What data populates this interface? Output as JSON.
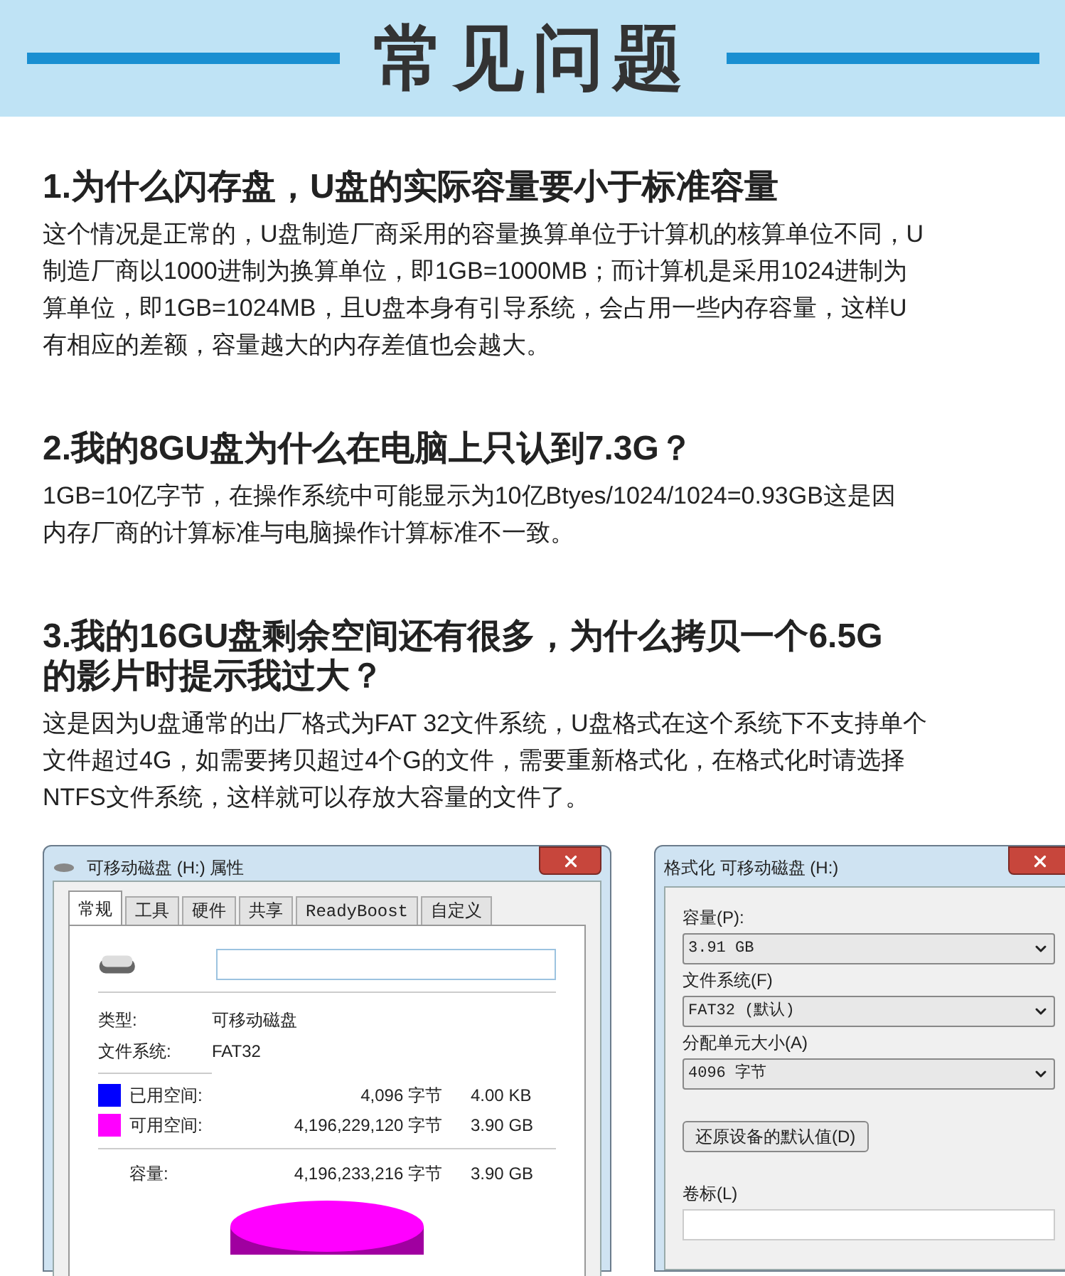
{
  "header": {
    "title": "常见问题"
  },
  "faq": [
    {
      "title_lines": [
        "1.为什么闪存盘，U盘的实际容量要小于标准容量"
      ],
      "body_lines": [
        "这个情况是正常的，U盘制造厂商采用的容量换算单位于计算机的核算单位不同，U",
        "制造厂商以1000进制为换算单位，即1GB=1000MB；而计算机是采用1024进制为",
        "算单位，即1GB=1024MB，且U盘本身有引导系统，会占用一些内存容量，这样U",
        "有相应的差额，容量越大的内存差值也会越大。"
      ]
    },
    {
      "title_lines": [
        "2.我的8GU盘为什么在电脑上只认到7.3G？"
      ],
      "body_lines": [
        "1GB=10亿字节，在操作系统中可能显示为10亿Btyes/1024/1024=0.93GB这是因",
        "内存厂商的计算标准与电脑操作计算标准不一致。"
      ]
    },
    {
      "title_lines": [
        "3.我的16GU盘剩余空间还有很多，为什么拷贝一个6.5G",
        "的影片时提示我过大？"
      ],
      "body_lines": [
        "这是因为U盘通常的出厂格式为FAT 32文件系统，U盘格式在这个系统下不支持单个",
        "文件超过4G，如需要拷贝超过4个G的文件，需要重新格式化，在格式化时请选择",
        "NTFS文件系统，这样就可以存放大容量的文件了。"
      ]
    }
  ],
  "properties_dialog": {
    "title": "可移动磁盘 (H:) 属性",
    "tabs": [
      {
        "label": "常规",
        "selected": true
      },
      {
        "label": "工具",
        "selected": false
      },
      {
        "label": "硬件",
        "selected": false
      },
      {
        "label": "共享",
        "selected": false
      },
      {
        "label": "ReadyBoost",
        "selected": false
      },
      {
        "label": "自定义",
        "selected": false
      }
    ],
    "info": [
      {
        "label": "类型:",
        "value": "可移动磁盘"
      },
      {
        "label": "文件系统:",
        "value": "FAT32"
      }
    ],
    "space": [
      {
        "label": "已用空间:",
        "color": "#0000ff",
        "bytes": "4,096 字节",
        "size": "4.00 KB"
      },
      {
        "label": "可用空间:",
        "color": "#ff00ff",
        "bytes": "4,196,229,120 字节",
        "size": "3.90 GB"
      }
    ],
    "capacity": {
      "label": "容量:",
      "bytes": "4,196,233,216 字节",
      "size": "3.90 GB"
    }
  },
  "format_dialog": {
    "title": "格式化 可移动磁盘 (H:)",
    "fields": [
      {
        "label": "容量(P):",
        "value": "3.91 GB"
      },
      {
        "label": "文件系统(F)",
        "value": "FAT32 (默认)"
      },
      {
        "label": "分配单元大小(A)",
        "value": "4096 字节"
      }
    ],
    "restore_button": "还原设备的默认值(D)",
    "volume_label": "卷标(L)"
  }
}
